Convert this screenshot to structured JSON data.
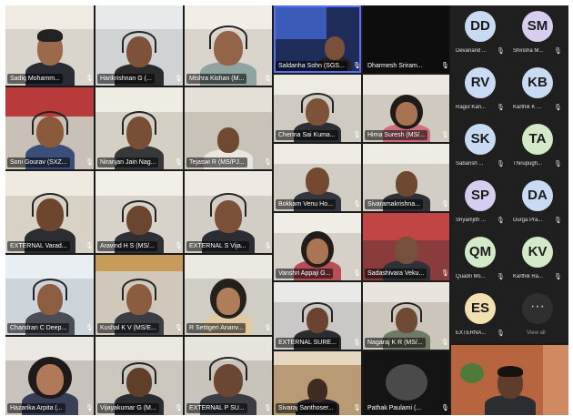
{
  "participants": [
    {
      "name": "Sadiq Mohamm..."
    },
    {
      "name": "Harikrishnan G (..."
    },
    {
      "name": "Mishra Kishan (M..."
    },
    {
      "name": "Saldanha Sohn (SGS..."
    },
    {
      "name": "Dharmesh Sriram..."
    },
    {
      "name": "Soni Gourav (SXZ..."
    },
    {
      "name": "Niranjan Jain Nag..."
    },
    {
      "name": "Tejaswi R (MS/PJ..."
    },
    {
      "name": "Chenna Sai Kuma..."
    },
    {
      "name": "Hima Suresh (MS/..."
    },
    {
      "name": "Bokkam Venu Ho..."
    },
    {
      "name": "Sivaramakrishna..."
    },
    {
      "name": "EXTERNAL Varad..."
    },
    {
      "name": "Aravind H S (MS/..."
    },
    {
      "name": "EXTERNAL S Vija..."
    },
    {
      "name": "Vanshri Appaji G..."
    },
    {
      "name": "Sadashivara Veku..."
    },
    {
      "name": "Chandran C Deep..."
    },
    {
      "name": "Kushal K V (MS/E..."
    },
    {
      "name": "R Settigeri Ananv..."
    },
    {
      "name": "EXTERNAL SURE..."
    },
    {
      "name": "Nagaraj K R (MS/..."
    },
    {
      "name": "Hazarika Arpita (..."
    },
    {
      "name": "Vijayakumar G (M..."
    },
    {
      "name": "EXTERNAL P SU..."
    },
    {
      "name": "Sivaraj Santhoser..."
    },
    {
      "name": "Pathak Paulami (..."
    }
  ],
  "side_panel": [
    {
      "initials": "DD",
      "name": "Devanand ...",
      "color": "#c9daf3"
    },
    {
      "initials": "SM",
      "name": "Shirisha M...",
      "color": "#d6cdef"
    },
    {
      "initials": "RV",
      "name": "Ragul Kan...",
      "color": "#c9daf3"
    },
    {
      "initials": "KB",
      "name": "Karthik K ...",
      "color": "#c9daf3"
    },
    {
      "initials": "SK",
      "name": "Sabarish ...",
      "color": "#c9daf3"
    },
    {
      "initials": "TA",
      "name": "Thirupugh...",
      "color": "#d3e9c8"
    },
    {
      "initials": "SP",
      "name": "Shyamjith ...",
      "color": "#d6cdef"
    },
    {
      "initials": "DA",
      "name": "Durga Pra...",
      "color": "#c9daf3"
    },
    {
      "initials": "QM",
      "name": "Quadri Ms...",
      "color": "#d3e9c8"
    },
    {
      "initials": "KV",
      "name": "Karthik Ra...",
      "color": "#d3e9c8"
    },
    {
      "initials": "ES",
      "name": "EXTERNA...",
      "color": "#f3e0b0"
    }
  ],
  "view_all": {
    "icon": "···",
    "label": "View all"
  },
  "mic_icon": "🎙"
}
